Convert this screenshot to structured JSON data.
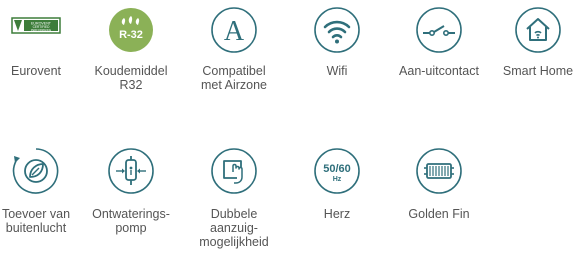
{
  "colors": {
    "icon_stroke": "#2f6f7b",
    "r32_badge": "#8bb157",
    "eurovent_green": "#3d7d3a",
    "label_text": "#555555"
  },
  "row1": [
    {
      "icon": "eurovent-logo",
      "lines": [
        "Eurovent"
      ],
      "logo_text": [
        "EUROVENT",
        "CERTIFIED",
        "PERFORMANCE"
      ]
    },
    {
      "icon": "r32-refrigerant-icon",
      "lines": [
        "Koudemiddel",
        "R32"
      ],
      "badge_text": "R-32"
    },
    {
      "icon": "airzone-icon",
      "lines": [
        "Compatibel",
        "met Airzone"
      ],
      "glyph": "A"
    },
    {
      "icon": "wifi-icon",
      "lines": [
        "Wifi"
      ]
    },
    {
      "icon": "switch-contact-icon",
      "lines": [
        "Aan-uitcontact"
      ]
    },
    {
      "icon": "smart-home-icon",
      "lines": [
        "Smart Home"
      ]
    }
  ],
  "row2": [
    {
      "icon": "fresh-air-intake-icon",
      "lines": [
        "Toevoer van",
        "buitenlucht"
      ]
    },
    {
      "icon": "drain-pump-icon",
      "lines": [
        "Ontwaterings-",
        "pomp"
      ]
    },
    {
      "icon": "dual-intake-icon",
      "lines": [
        "Dubbele",
        "aanzuig-",
        "mogelijkheid"
      ]
    },
    {
      "icon": "frequency-icon",
      "lines": [
        "Herz"
      ],
      "badge_main": "50/60",
      "badge_sub": "Hz"
    },
    {
      "icon": "golden-fin-icon",
      "lines": [
        "Golden Fin"
      ]
    }
  ]
}
